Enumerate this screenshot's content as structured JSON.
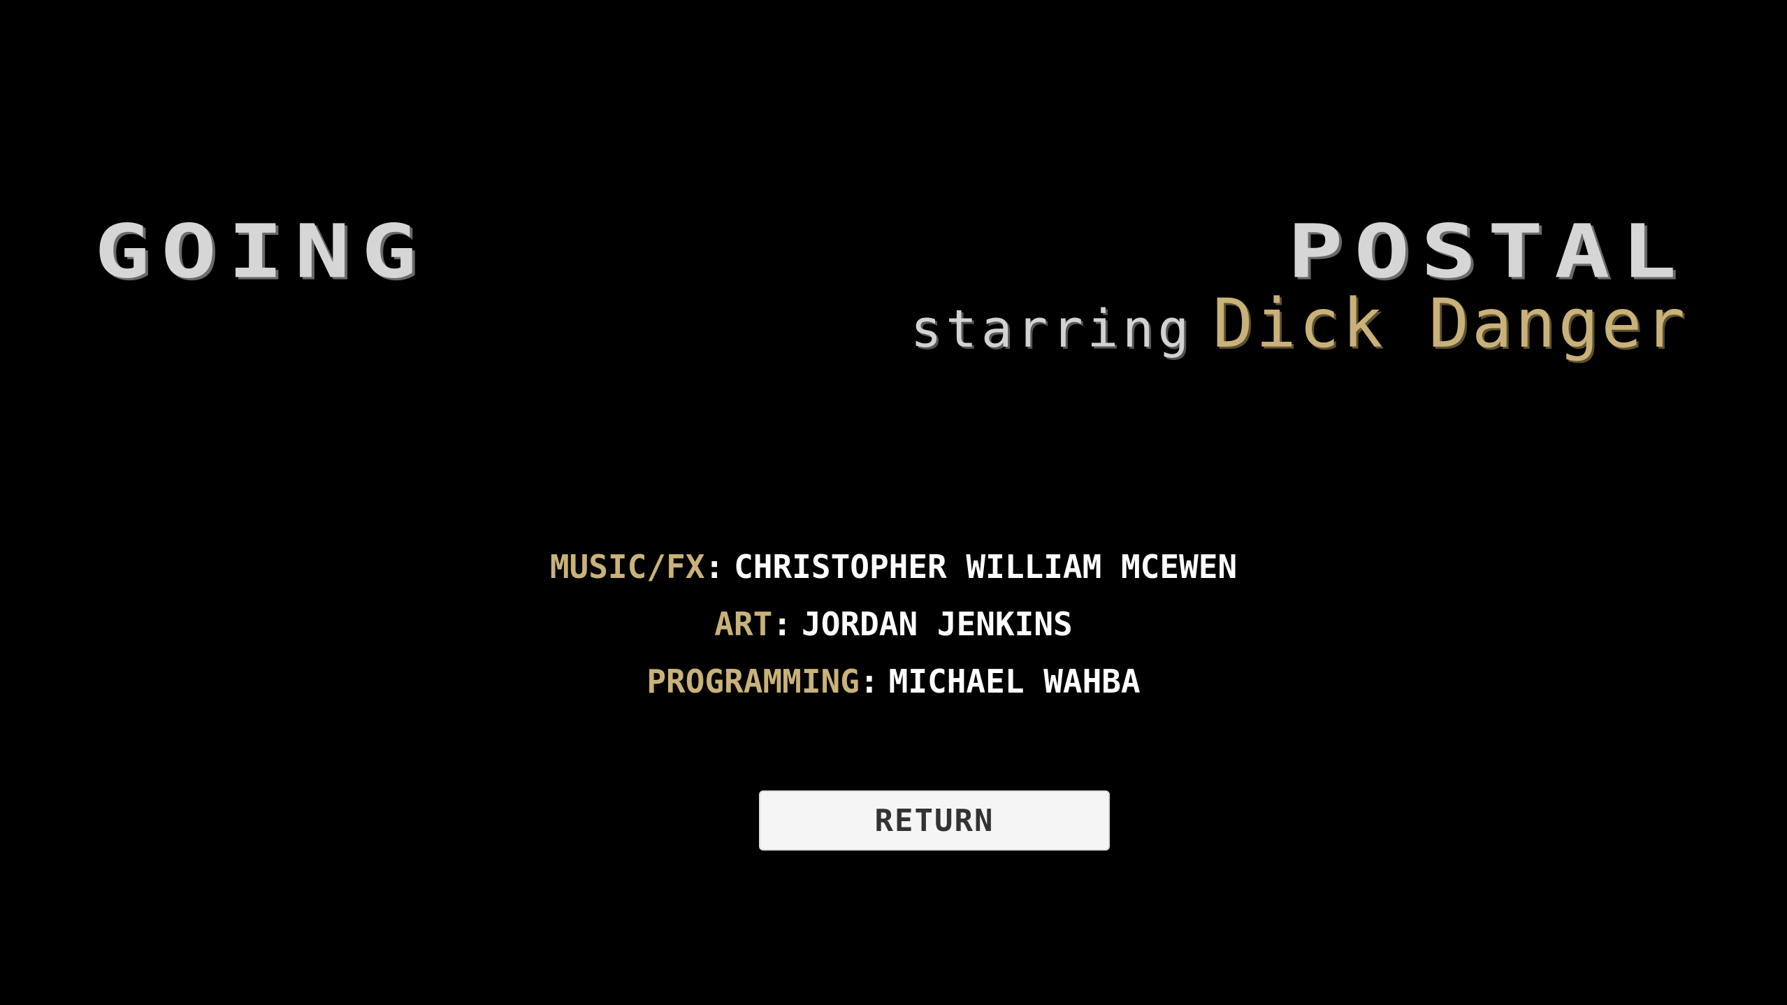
{
  "logo": {
    "title": "GOING POSTAL",
    "starring": "starring",
    "star_name": "Dick Danger"
  },
  "credits": [
    {
      "role": "MUSIC/FX",
      "separator": ":",
      "name": "CHRISTOPHER WILLIAM MCEWEN"
    },
    {
      "role": "ART",
      "separator": ":",
      "name": "JORDAN JENKINS"
    },
    {
      "role": "PROGRAMMING",
      "separator": ":",
      "name": "MICHAEL WAHBA"
    }
  ],
  "return_button": {
    "label": "RETURN"
  },
  "colors": {
    "background": "#000000",
    "title": "#d6d6d6",
    "accent_gold": "#c9b27a",
    "credit_text": "#ffffff",
    "button_bg": "#f5f5f5",
    "button_text": "#333333"
  }
}
